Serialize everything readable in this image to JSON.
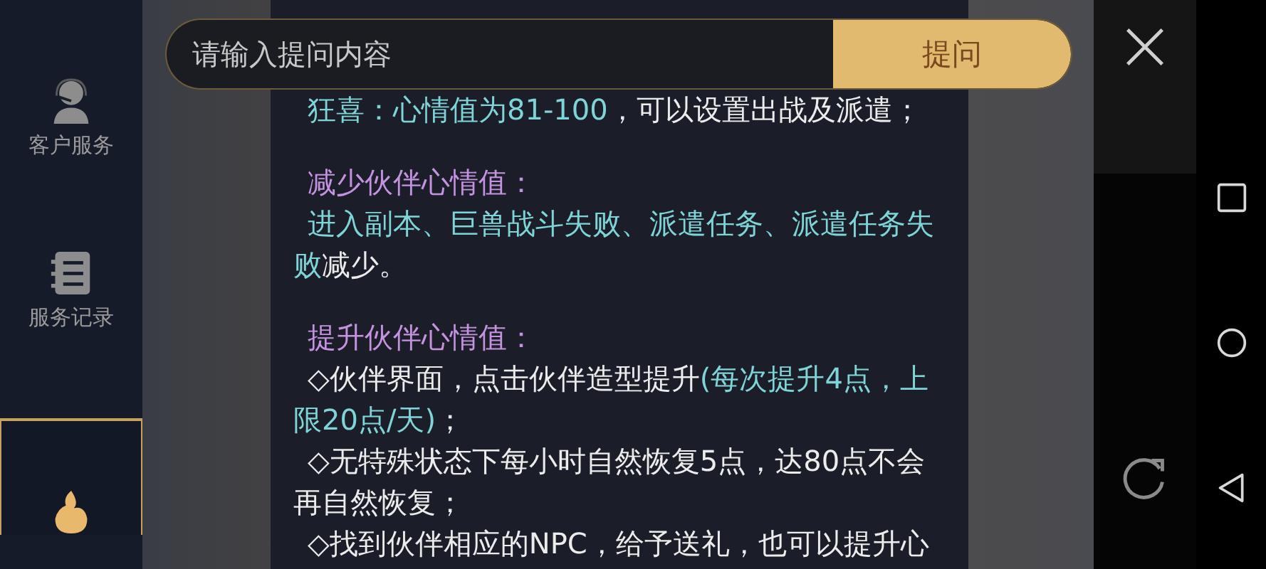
{
  "sidebar": {
    "items": [
      {
        "kind": "headset",
        "label": "客户服务",
        "selected": false
      },
      {
        "kind": "notebook",
        "label": "服务记录",
        "selected": false
      },
      {
        "kind": "flame",
        "selected": true
      }
    ]
  },
  "search": {
    "placeholder": "请输入提问内容",
    "button": "提问"
  },
  "content": {
    "sections": [
      {
        "paragraphs": [
          {
            "kind": "text",
            "segments": [
              {
                "kind": "highlight",
                "text": "狂喜：心情值为81-100"
              },
              {
                "kind": "plain",
                "text": "，可以设置出战及派遣；"
              }
            ]
          }
        ]
      },
      {
        "paragraphs": [
          {
            "kind": "heading",
            "segments": [
              {
                "kind": "plain",
                "text": "减少伙伴心情值："
              }
            ]
          },
          {
            "kind": "text",
            "segments": [
              {
                "kind": "highlight",
                "text": "进入副本、巨兽战斗失败、派遣任务、派遣任务失败"
              },
              {
                "kind": "plain",
                "text": "减少。"
              }
            ]
          }
        ]
      },
      {
        "paragraphs": [
          {
            "kind": "heading",
            "segments": [
              {
                "kind": "plain",
                "text": "提升伙伴心情值："
              }
            ]
          },
          {
            "kind": "text",
            "segments": [
              {
                "kind": "plain",
                "text": "◇伙伴界面，点击伙伴造型提升"
              },
              {
                "kind": "highlight",
                "text": "(每次提升4点，上限20点/天)"
              },
              {
                "kind": "plain",
                "text": "；"
              }
            ]
          },
          {
            "kind": "text",
            "segments": [
              {
                "kind": "plain",
                "text": "◇无特殊状态下每小时自然恢复5点，达80点不会再自然恢复；"
              }
            ]
          },
          {
            "kind": "text",
            "segments": [
              {
                "kind": "plain",
                "text": "◇找到伙伴相应的NPC，给予送礼，也可以提升心"
              }
            ]
          }
        ]
      }
    ]
  }
}
